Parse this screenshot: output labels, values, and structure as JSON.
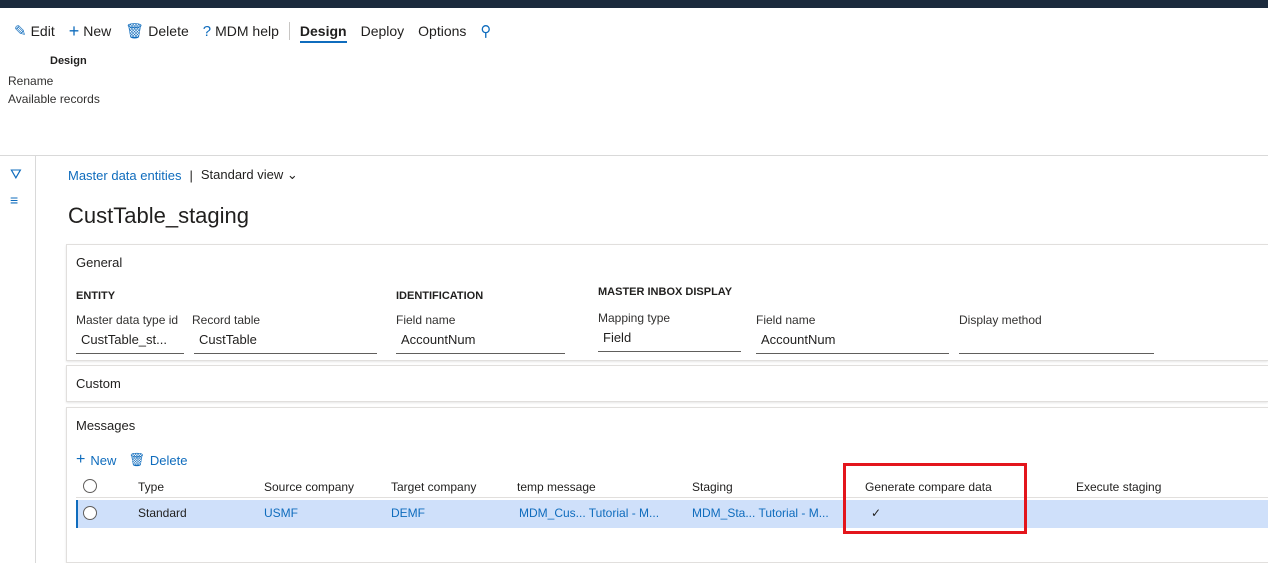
{
  "commands": {
    "edit": "Edit",
    "new": "New",
    "delete": "Delete",
    "help": "MDM help",
    "tabs": [
      "Design",
      "Deploy",
      "Options"
    ]
  },
  "design_group": {
    "title": "Design",
    "items": [
      "Rename",
      "Available records"
    ]
  },
  "breadcrumb": {
    "link": "Master data entities",
    "separator": "|",
    "view": "Standard view"
  },
  "page_title": "CustTable_staging",
  "general": {
    "header": "General",
    "entity": {
      "group": "ENTITY",
      "type_id_label": "Master data type id",
      "type_id_value": "CustTable_st...",
      "record_table_label": "Record table",
      "record_table_value": "CustTable"
    },
    "identification": {
      "group": "IDENTIFICATION",
      "field_name_label": "Field name",
      "field_name_value": "AccountNum"
    },
    "master_inbox": {
      "group": "MASTER INBOX DISPLAY",
      "mapping_type_label": "Mapping type",
      "mapping_type_value": "Field",
      "field_name_label": "Field name",
      "field_name_value": "AccountNum",
      "display_method_label": "Display method",
      "display_method_value": ""
    }
  },
  "custom": {
    "header": "Custom"
  },
  "messages": {
    "header": "Messages",
    "new": "New",
    "delete": "Delete",
    "columns": [
      "Type",
      "Source company",
      "Target company",
      "temp message",
      "Staging",
      "Generate compare data",
      "Execute staging"
    ],
    "rows": [
      {
        "type": "Standard",
        "source_company": "USMF",
        "target_company": "DEMF",
        "temp_message": "MDM_Cus... Tutorial - M...",
        "staging": "MDM_Sta... Tutorial - M...",
        "generate_compare_data": "✓",
        "execute_staging": ""
      }
    ]
  },
  "colors": {
    "accent": "#0f6cbd",
    "row_selected": "#cfe0fa",
    "highlight_box": "#e3151c"
  }
}
